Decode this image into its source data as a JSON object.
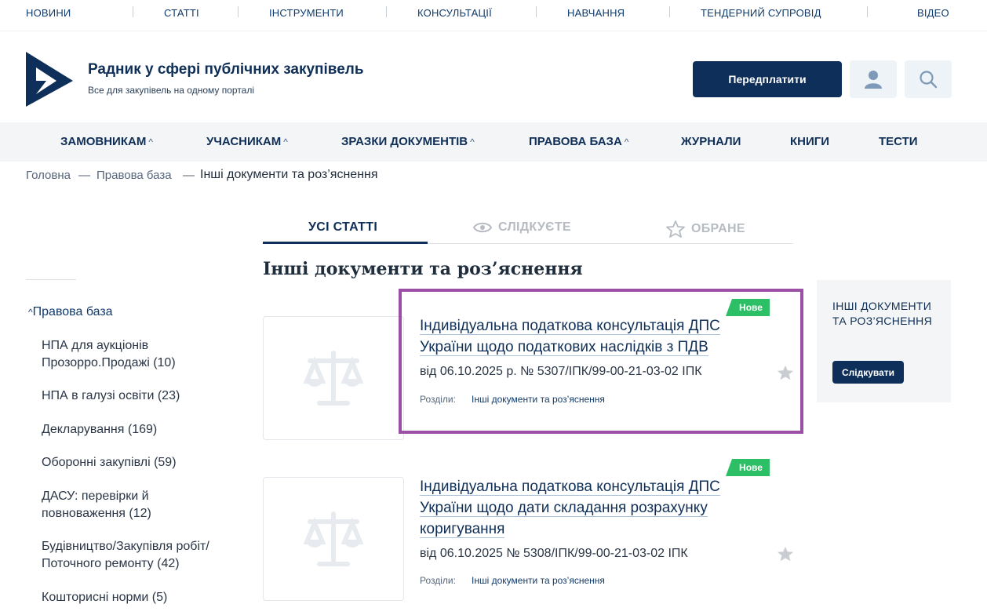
{
  "topnav": {
    "items": [
      "НОВИНИ",
      "СТАТТІ",
      "ІНСТРУМЕНТИ",
      "КОНСУЛЬТАЦІЇ",
      "НАВЧАННЯ",
      "ТЕНДЕРНИЙ СУПРОВІД",
      "ВІДЕО"
    ]
  },
  "header": {
    "title": "Радник у сфері публічних закупівель",
    "subtitle": "Все для закупівель на одному порталі",
    "subscribe_label": "Передплатити",
    "icons": [
      "user-icon",
      "search-icon"
    ]
  },
  "mainmenu": {
    "items": [
      "ЗАМОВНИКАМ",
      "УЧАСНИКАМ",
      "ЗРАЗКИ ДОКУМЕНТІВ",
      "ПРАВОВА БАЗА",
      "ЖУРНАЛИ",
      "КНИГИ",
      "ТЕСТИ"
    ],
    "chevron": "^"
  },
  "breadcrumb": {
    "items": [
      "Головна",
      "Правова база",
      "Інші документи та роз’яснення"
    ],
    "separator": "—"
  },
  "tabs": {
    "all": "УСІ СТАТТІ",
    "following": "СЛІДКУЄТЕ",
    "favorites": "ОБРАНЕ"
  },
  "section_title": "Інші документи та роз’яснення",
  "sidebar": {
    "head": "Правова база",
    "items": [
      "НПА для аукціонів Прозорро.Продажі (10)",
      "НПА в галузі освіти (23)",
      "Декларування (169)",
      "Оборонні закупівлі (59)",
      "ДАСУ: перевірки й повноваження (12)",
      "Будівництво/Закупівля робіт/ Поточного ремонту (42)",
      "Кошторисні норми (5)"
    ]
  },
  "articles": [
    {
      "badge": "Нове",
      "title": "Індивідуальна податкова консультація ДПС України щодо податкових наслідків з ПДВ",
      "meta": "від 06.10.2025 р. № 5307/ІПК/99-00-21-03-02 ІПК",
      "sections_label": "Розділи:",
      "section": "Інші документи та роз’яснення"
    },
    {
      "badge": "Нове",
      "title": "Індивідуальна податкова консультація ДПС України щодо дати складання розрахунку коригування",
      "meta": "від 06.10.2025 № 5308/ІПК/99-00-21-03-02 ІПК",
      "sections_label": "Розділи:",
      "section": "Інші документи та роз’яснення"
    }
  ],
  "follow_box": {
    "title": "ІНШІ ДОКУМЕНТИ ТА РОЗ’ЯСНЕННЯ",
    "button": "Слідкувати"
  },
  "colors": {
    "brand": "#0d2f5a",
    "badge": "#2dbf66",
    "highlight": "#9b4fa5"
  }
}
